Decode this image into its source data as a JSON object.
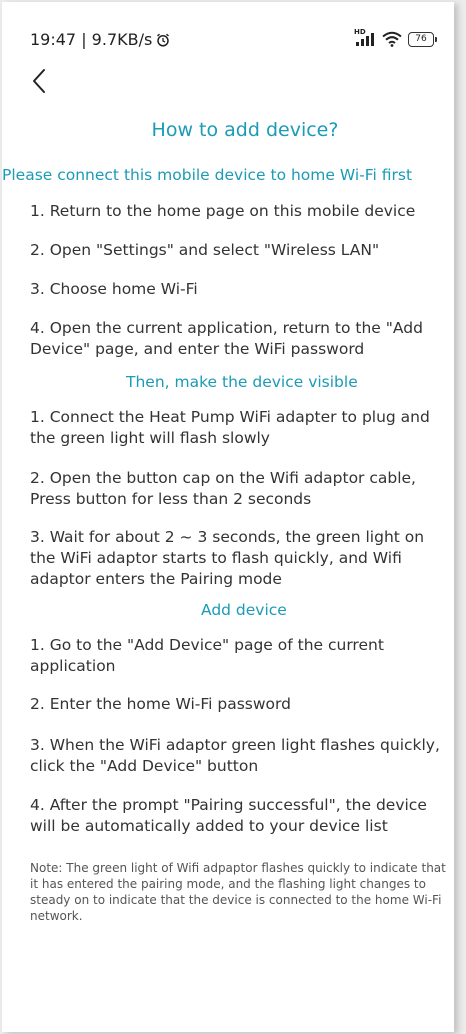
{
  "status_bar": {
    "time_speed": "19:47 | 9.7KB/s",
    "alarm_icon": "alarm-clock-icon",
    "signal_label": "HD",
    "battery": "76"
  },
  "header": {
    "back_icon": "chevron-left-icon",
    "title": "How to add device?"
  },
  "sections": [
    {
      "heading": "Please connect this mobile device to home Wi-Fi first",
      "steps": [
        "1. Return to the home page on this mobile device",
        "2. Open \"Settings\" and select \"Wireless LAN\"",
        "3. Choose home Wi-Fi",
        "4. Open the current application, return to the \"Add Device\" page, and enter the WiFi password"
      ]
    },
    {
      "heading": "Then, make the device visible",
      "steps": [
        "1. Connect the Heat Pump WiFi adapter to plug and the green light will flash slowly",
        "2. Open the button cap on the Wifi adaptor cable, Press button for less than 2 seconds",
        "3. Wait for about 2 ~ 3 seconds, the green light on the WiFi adaptor starts to flash quickly, and Wifi adaptor enters the Pairing mode"
      ]
    },
    {
      "heading": "Add device",
      "steps": [
        "1. Go to the \"Add Device\" page of the current application",
        "2. Enter the home Wi-Fi password",
        "3. When the WiFi adaptor green light flashes quickly, click the \"Add Device\" button",
        "4. After the prompt \"Pairing successful\", the device will be automatically added to your device list"
      ]
    }
  ],
  "note": "Note: The green light of Wifi adpaptor flashes quickly to indicate that it has entered the pairing mode, and the flashing light changes to steady on to indicate that the device is connected to the home Wi-Fi network.",
  "colors": {
    "accent": "#1b9bb5",
    "text": "#333333",
    "background": "#ffffff"
  }
}
